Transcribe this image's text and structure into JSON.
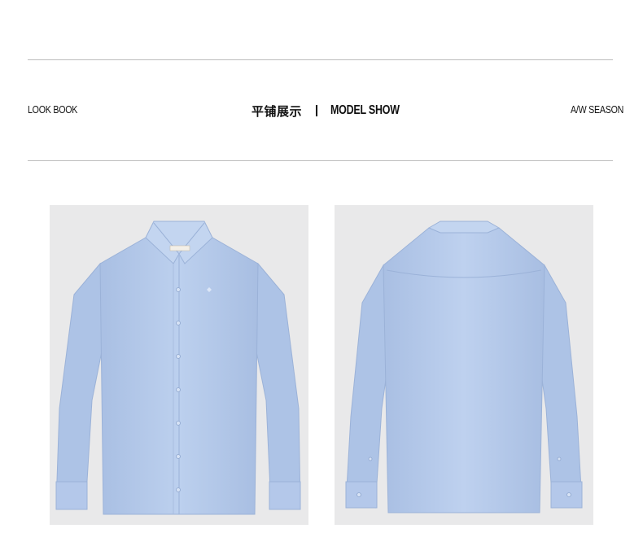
{
  "header": {
    "left_label": "LOOK BOOK",
    "center_title_cn": "平铺展示",
    "center_title_en": "MODEL SHOW",
    "right_label": "A/W SEASON"
  },
  "images": {
    "front": {
      "alt": "shirt-front",
      "color": "#b9cdeb"
    },
    "back": {
      "alt": "shirt-back",
      "color": "#b9cdeb"
    }
  }
}
